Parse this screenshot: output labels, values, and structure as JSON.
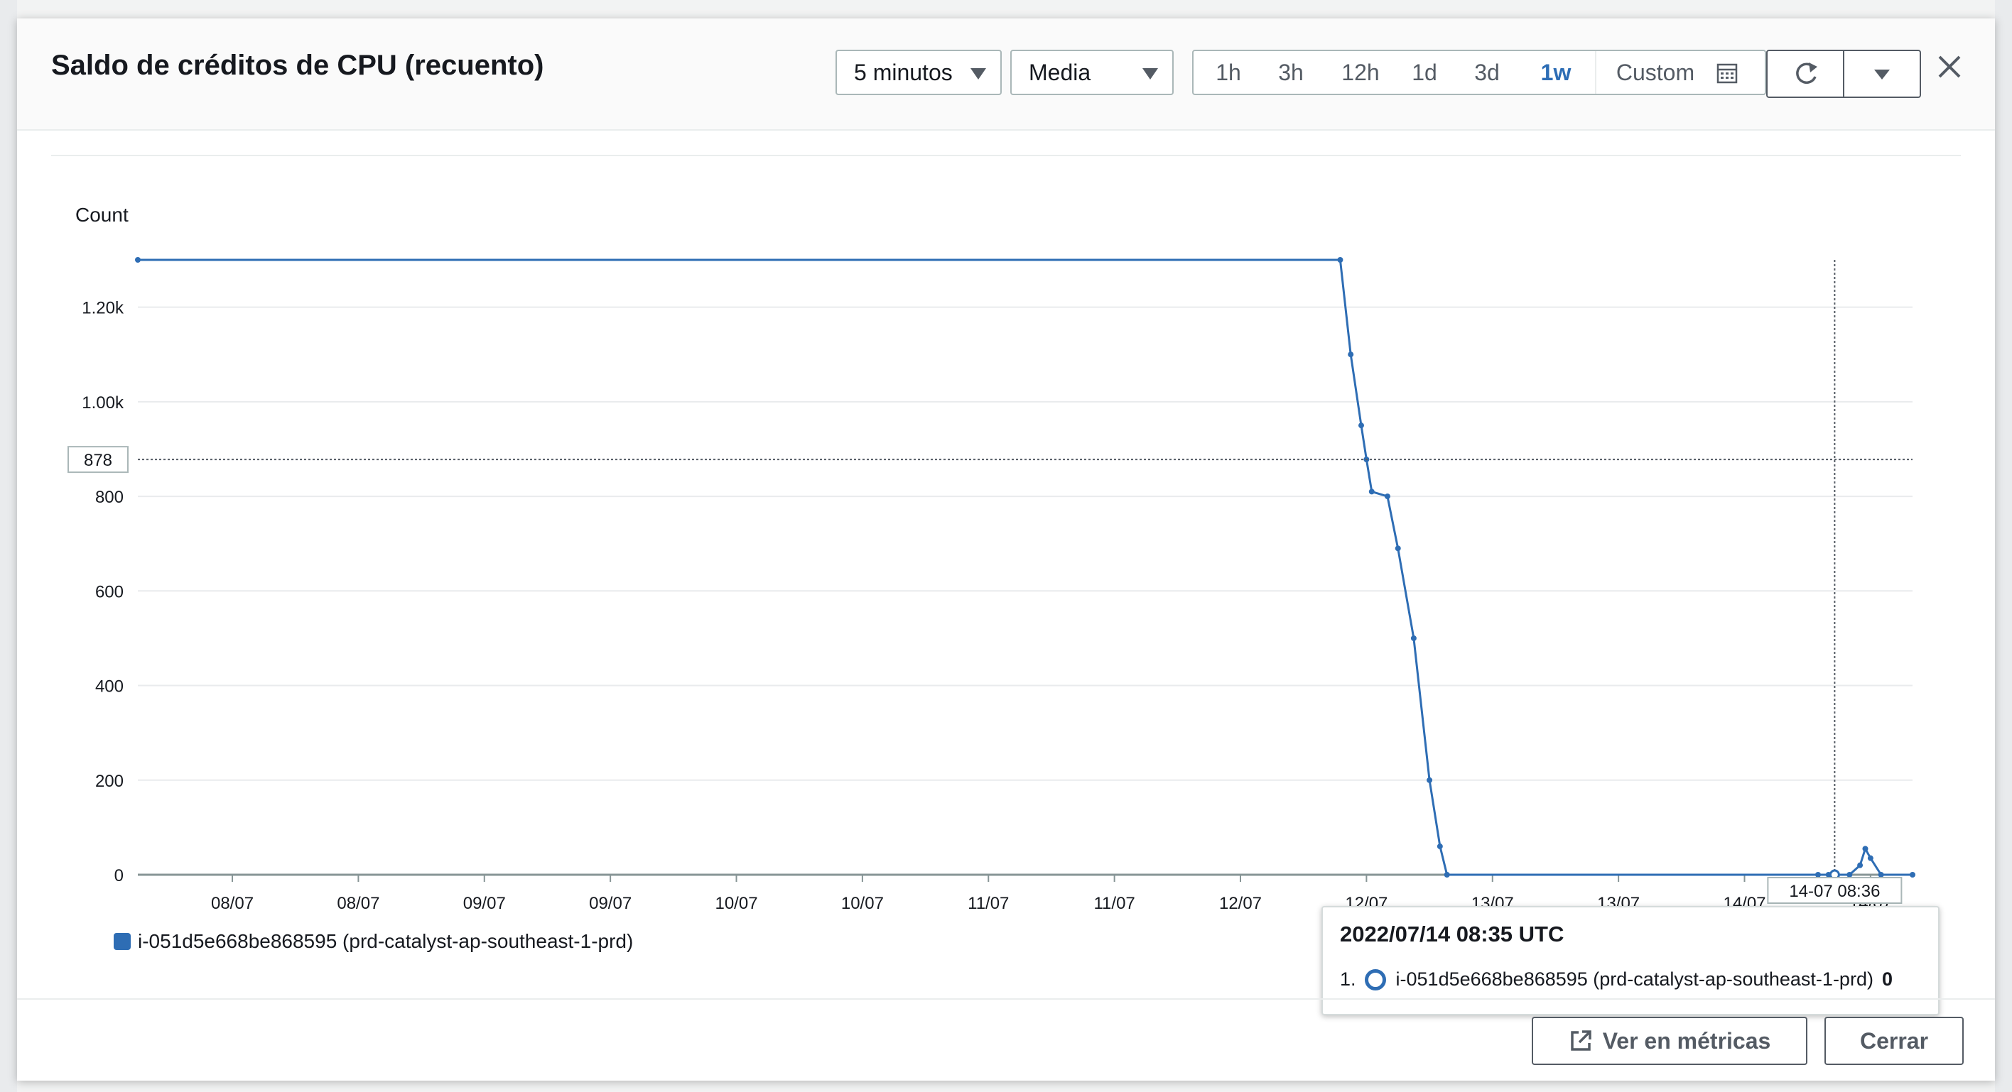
{
  "colors": {
    "series": "#2e6db4",
    "grid": "#e9ebed",
    "axis": "#879596",
    "accent": "#2d6db5"
  },
  "modal": {
    "title": "Saldo de créditos de CPU (recuento)",
    "period_select": "5 minutos",
    "stat_select": "Media",
    "ranges": [
      "1h",
      "3h",
      "12h",
      "1d",
      "3d",
      "1w",
      "Custom"
    ],
    "active_range": "1w",
    "icons": {
      "calendar": "calendar-icon",
      "refresh": "refresh-icon",
      "more": "caret-down-icon",
      "close": "close-icon",
      "external": "external-link-icon"
    }
  },
  "chart_data": {
    "type": "line",
    "title": "",
    "ylabel": "Count",
    "ylim": [
      0,
      1300
    ],
    "yticks": [
      0,
      200,
      400,
      600,
      800,
      1000,
      1200
    ],
    "ytick_labels": [
      "0",
      "200",
      "400",
      "600",
      "800",
      "1.00k",
      "1.20k"
    ],
    "xlim": [
      "2022-07-07T15:00",
      "2022-07-14T16:00"
    ],
    "xticks": [
      "2022-07-08T00:00",
      "2022-07-08T12:00",
      "2022-07-09T00:00",
      "2022-07-09T12:00",
      "2022-07-10T00:00",
      "2022-07-10T12:00",
      "2022-07-11T00:00",
      "2022-07-11T12:00",
      "2022-07-12T00:00",
      "2022-07-12T12:00",
      "2022-07-13T00:00",
      "2022-07-13T12:00",
      "2022-07-14T00:00",
      "2022-07-14T12:00"
    ],
    "xtick_labels": [
      "08/07",
      "08/07",
      "09/07",
      "09/07",
      "10/07",
      "10/07",
      "11/07",
      "11/07",
      "12/07",
      "12/07",
      "13/07",
      "13/07",
      "14/07",
      "14/07"
    ],
    "grid": true,
    "legend_position": "bottom-left",
    "series": [
      {
        "name": "i-051d5e668be868595 (prd-catalyst-ap-southeast-1-prd)",
        "x": [
          "2022-07-07T15:00",
          "2022-07-12T09:30",
          "2022-07-12T10:30",
          "2022-07-12T11:30",
          "2022-07-12T12:00",
          "2022-07-12T12:30",
          "2022-07-12T14:00",
          "2022-07-12T15:00",
          "2022-07-12T16:30",
          "2022-07-12T18:00",
          "2022-07-12T19:00",
          "2022-07-12T19:40",
          "2022-07-14T07:00",
          "2022-07-14T08:00",
          "2022-07-14T08:35",
          "2022-07-14T10:00",
          "2022-07-14T11:00",
          "2022-07-14T11:30",
          "2022-07-14T12:00",
          "2022-07-14T13:00",
          "2022-07-14T16:00"
        ],
        "y": [
          1300,
          1300,
          1100,
          950,
          878,
          810,
          800,
          690,
          500,
          200,
          60,
          0,
          0,
          0,
          0,
          0,
          20,
          55,
          35,
          0,
          0
        ]
      }
    ],
    "crosshair": {
      "x": "2022-07-14T08:35",
      "x_label": "14-07 08:36",
      "y": 878,
      "y_label": "878"
    }
  },
  "tooltip": {
    "title": "2022/07/14 08:35 UTC",
    "index": "1.",
    "series": "i-051d5e668be868595 (prd-catalyst-ap-southeast-1-prd)",
    "value": "0"
  },
  "footer": {
    "view_metrics": "Ver en métricas",
    "close": "Cerrar"
  }
}
